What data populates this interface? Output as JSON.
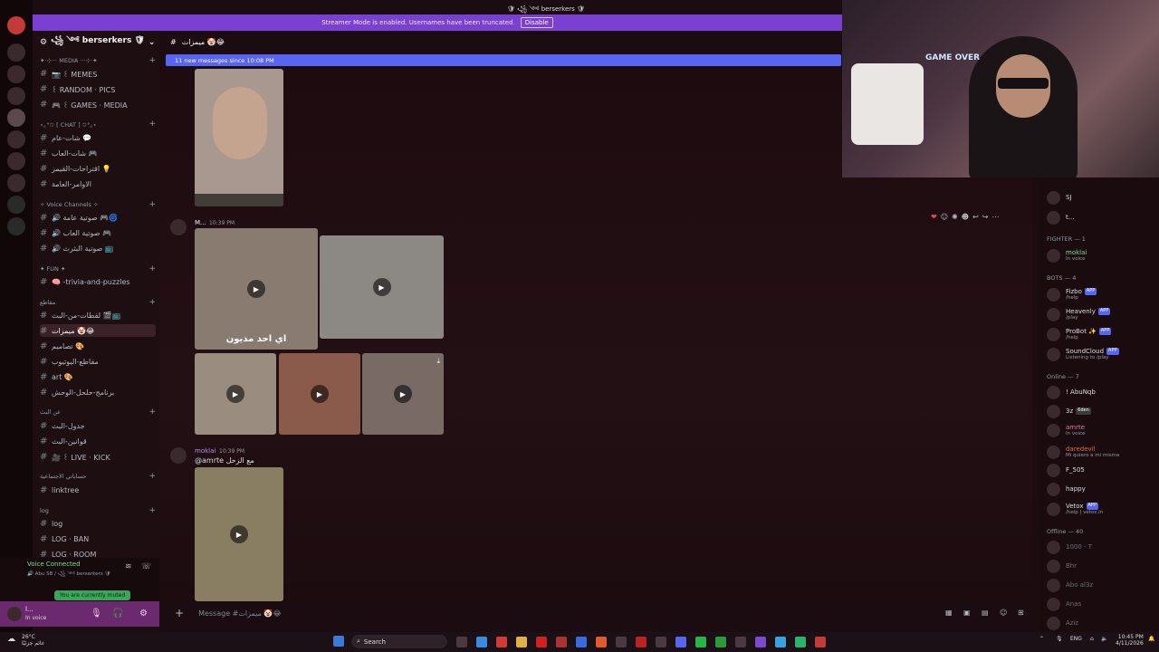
{
  "window": {
    "title": "🛡 ꧁ ༺ berserkers 🛡"
  },
  "banner": {
    "text": "Streamer Mode is enabled. Usernames have been truncated.",
    "button": "Disable"
  },
  "server": {
    "name": "꧁ ༺ berserkers 🛡"
  },
  "channels": [
    {
      "label": "✦·⊹··· MEDIA ···⊹·✦",
      "type": "cat"
    },
    {
      "label": "📷 ꒰ MEMES",
      "type": "ch"
    },
    {
      "label": "꒰ RANDOM · PICS",
      "type": "ch"
    },
    {
      "label": "🎮 ꒰ GAMES · MEDIA",
      "type": "ch"
    },
    {
      "label": "⋆｡°✩ [ CHAT ] ✩°｡⋆",
      "type": "cat"
    },
    {
      "label": "شات-عام 💬",
      "type": "ch"
    },
    {
      "label": "شات-العاب 🎮",
      "type": "ch"
    },
    {
      "label": "اقتراحات-القيمز 💡",
      "type": "ch"
    },
    {
      "label": "الاوامر-العامة",
      "type": "ch"
    },
    {
      "label": "✧ Voice Channels ✧",
      "type": "cat"
    },
    {
      "label": "🔊 صوتية عامة 🎮🌀",
      "type": "ch"
    },
    {
      "label": "🔊 صوتية العاب 🎮",
      "type": "ch"
    },
    {
      "label": "🔊 صوتية البثرث 📺",
      "type": "ch"
    },
    {
      "label": "✦ FUN ✦",
      "type": "cat"
    },
    {
      "label": "🧠 -trivia-and-puzzles",
      "type": "ch"
    },
    {
      "label": "مقاطع",
      "type": "cat"
    },
    {
      "label": "لقطات-من-البث 🎬📺",
      "type": "ch"
    },
    {
      "label": "ميمزات 🤡😂",
      "type": "ch"
    },
    {
      "label": "تصاميم 🎨",
      "type": "ch"
    },
    {
      "label": "مقاطع-اليوتيوب",
      "type": "ch"
    },
    {
      "label": "art 🎨",
      "type": "ch"
    },
    {
      "label": "برنامج-حلحل-الوحش",
      "type": "ch"
    },
    {
      "label": "عن البث",
      "type": "cat"
    },
    {
      "label": "جدول-البث",
      "type": "ch"
    },
    {
      "label": "قوانين-البث",
      "type": "ch"
    },
    {
      "label": "🎥 ꒰ LIVE · KICK",
      "type": "ch"
    },
    {
      "label": "حساباتي الاجتماعية",
      "type": "cat"
    },
    {
      "label": "linktree",
      "type": "ch"
    },
    {
      "label": "log",
      "type": "cat"
    },
    {
      "label": "log",
      "type": "ch"
    },
    {
      "label": "LOG · BAN",
      "type": "ch"
    },
    {
      "label": "LOG · ROOM",
      "type": "ch"
    }
  ],
  "chat": {
    "channel_name": "ميمزات 🤡😂",
    "new_messages": "11 new messages since 10:08 PM",
    "msg1": {
      "author": "M...",
      "time": "10:39 PM",
      "caption": "اي احد مديون"
    },
    "msg2": {
      "author": "moklai",
      "time": "10:39 PM",
      "text": "@amrte مع الزحل"
    },
    "placeholder": "Message #ميمزات 🤡😂"
  },
  "voice": {
    "status": "Voice Connected",
    "channel": "🔊 Abu SB / ꧁ ༺ berserkers 🛡",
    "muted": "You are currently muted"
  },
  "user": {
    "name": "ا...",
    "status": "In voice"
  },
  "members": {
    "fighter_header": "FIGHTER — 1",
    "bots_header": "BOTS — 4",
    "online_header": "Online — 7",
    "offline_header": "Offline — 40",
    "top": [
      {
        "name": "SJ",
        "sub": ""
      },
      {
        "name": "t...",
        "sub": ""
      }
    ],
    "fighter": [
      {
        "name": "moklai",
        "sub": "In voice",
        "color": "#7ee08a"
      }
    ],
    "bots": [
      {
        "name": "Fizbo",
        "sub": "/help",
        "badge": "APP"
      },
      {
        "name": "Heavenly",
        "sub": "/play",
        "badge": "APP"
      },
      {
        "name": "ProBot ✨",
        "sub": "/help",
        "badge": "APP"
      },
      {
        "name": "SoundCloud",
        "sub": "Listening to /play",
        "badge": "APP"
      }
    ],
    "online": [
      {
        "name": "! AbuNqb",
        "sub": ""
      },
      {
        "name": "3z",
        "sub": "",
        "extra": "6den"
      },
      {
        "name": "amrte",
        "sub": "In voice",
        "color": "#e47aa0"
      },
      {
        "name": "daredevil",
        "sub": "Mi quiero a mi misma",
        "color": "#e86a4a"
      },
      {
        "name": "F_505",
        "sub": ""
      },
      {
        "name": "happy",
        "sub": ""
      },
      {
        "name": "Vetox",
        "sub": "/help | vetox.in",
        "badge": "APP"
      }
    ],
    "offline": [
      {
        "name": "1000 - T"
      },
      {
        "name": "Bhr"
      },
      {
        "name": "Abo al3z"
      },
      {
        "name": "Anas"
      },
      {
        "name": "Aziz"
      }
    ]
  },
  "webcam": {
    "sign": "GAME OVER"
  },
  "taskbar": {
    "search": "Search",
    "weather_temp": "26°C",
    "weather_desc": "غائم جزئيًا",
    "lang": "ENG",
    "time": "10:45 PM",
    "date": "4/11/2026"
  }
}
